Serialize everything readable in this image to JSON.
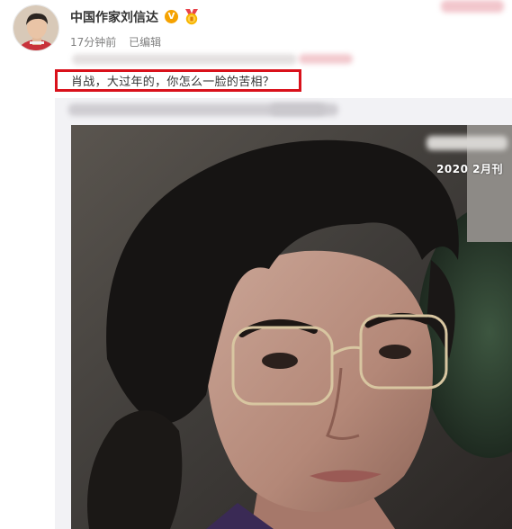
{
  "post": {
    "author_name": "中国作家刘信达",
    "time": "17分钟前",
    "edited": "已编辑",
    "text": "肖战，大过年的，你怎么一脸的苦相？"
  },
  "repost": {
    "photo_caption": "2020 2月刊"
  },
  "badges": {
    "verified_glyph": "V",
    "verified_color": "#f5a200",
    "highlight_color": "#d9111b"
  },
  "icons": [
    "avatar",
    "verified-badge-icon",
    "medal-icon"
  ]
}
